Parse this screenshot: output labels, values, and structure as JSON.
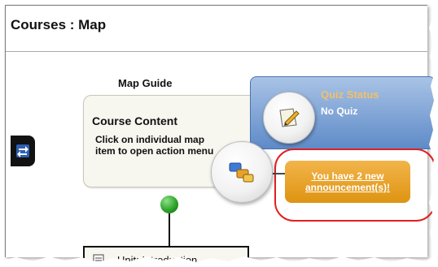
{
  "header": {
    "title": "Courses : Map"
  },
  "map_guide": {
    "label": "Map Guide",
    "course_content_title": "Course Content",
    "course_content_text": "Click on individual map item to open action menu"
  },
  "quiz_status": {
    "title": "Quiz Status",
    "value": "No Quiz"
  },
  "announcement": {
    "line1": "You have 2 new",
    "line2": "announcement(s)!"
  },
  "unit_item": {
    "label": "Unit: Introduction"
  },
  "icons": {
    "left_tab": "swap-arrows-icon",
    "quiz": "pencil-paper-icon",
    "content": "content-blocks-icon",
    "unit": "document-icon",
    "status_dot": "green-status-dot"
  },
  "colors": {
    "quiz_bg": "#5e8bc8",
    "quiz_title": "#f1c06a",
    "announce_bg": "#de9412",
    "highlight": "#e02020"
  }
}
